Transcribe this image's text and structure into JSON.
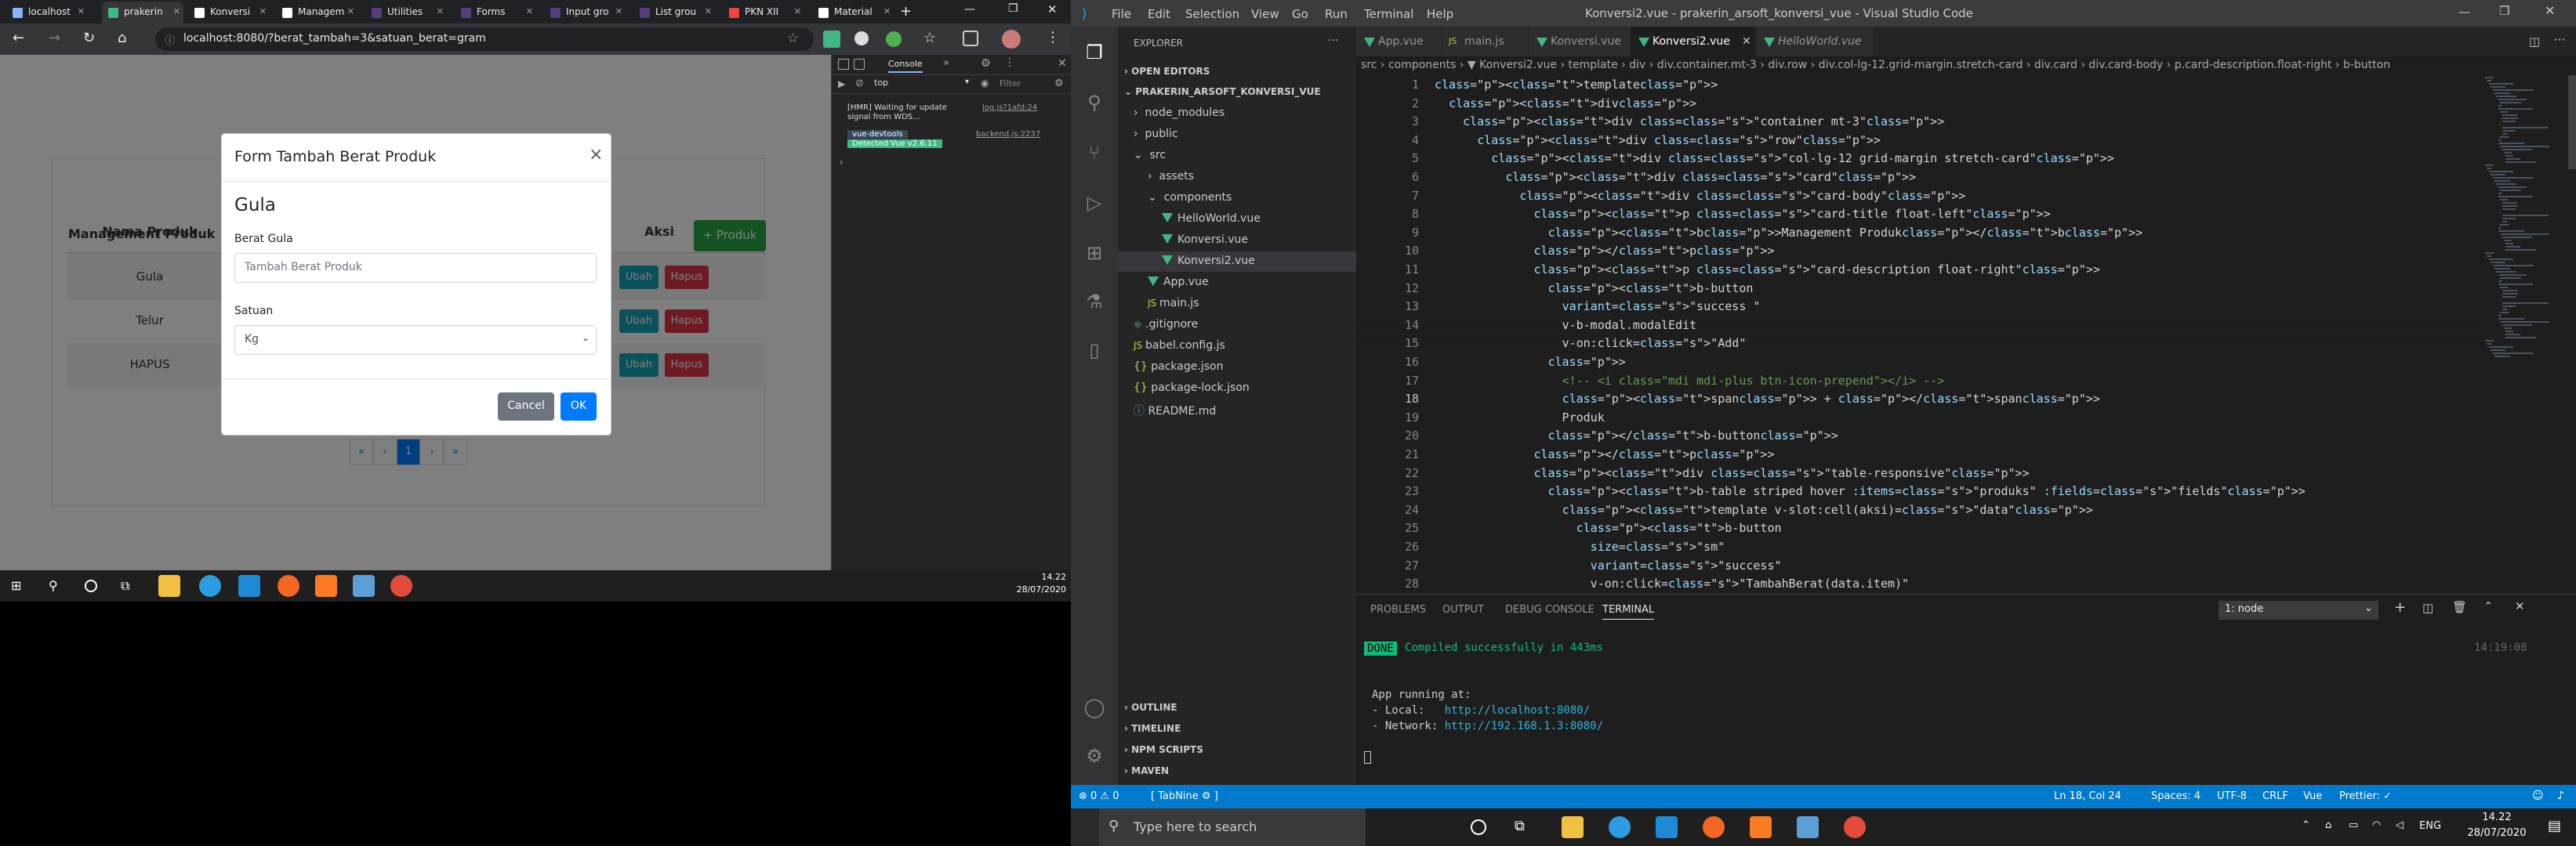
{
  "chrome": {
    "tabs": [
      "localhost",
      "prakerin",
      "Konversi",
      "Managem",
      "Utilities",
      "Forms",
      "Input gro",
      "List grou",
      "PKN XII",
      "Material"
    ],
    "url": "localhost:8080/?berat_tambah=3&satuan_berat=gram"
  },
  "page": {
    "card_title": "Management Produk",
    "add_button": "+ Produk",
    "columns": [
      "Nama Produk",
      "Aksi"
    ],
    "rows": [
      {
        "name": "Gula",
        "edit": "Ubah",
        "delete": "Hapus"
      },
      {
        "name": "Telur",
        "edit": "Ubah",
        "delete": "Hapus"
      },
      {
        "name": "HAPUS",
        "edit": "Ubah",
        "delete": "Hapus"
      }
    ],
    "pagination": [
      "«",
      "‹",
      "1",
      "›",
      "»"
    ]
  },
  "modal": {
    "title": "Form Tambah Berat Produk",
    "close": "×",
    "product": "Gula",
    "weight_label": "Berat Gula",
    "weight_placeholder": "Tambah Berat Produk",
    "unit_label": "Satuan",
    "unit_value": "Kg",
    "cancel": "Cancel",
    "ok": "OK"
  },
  "devtools": {
    "tab": "Console",
    "context": "top",
    "filter": "Filter",
    "log1": "[HMR] Waiting for update signal from WDS...",
    "log1_src": "log.js?1afd:24",
    "log2a": "vue-devtools",
    "log2b": "Detected Vue v2.6.11",
    "log2_src": "backend.js:2237",
    "prompt": "›"
  },
  "left_taskbar": {
    "time": "14.22",
    "date": "28/07/2020"
  },
  "vscode": {
    "title": "Konversi2.vue - prakerin_arsoft_konversi_vue - Visual Studio Code",
    "menu": [
      "File",
      "Edit",
      "Selection",
      "View",
      "Go",
      "Run",
      "Terminal",
      "Help"
    ],
    "explorer": {
      "header": "EXPLORER",
      "open_editors": "OPEN EDITORS",
      "project": "PRAKERIN_ARSOFT_KONVERSI_VUE",
      "items": [
        {
          "label": "node_modules",
          "type": "folder"
        },
        {
          "label": "public",
          "type": "folder"
        },
        {
          "label": "src",
          "type": "folder-open"
        },
        {
          "label": "assets",
          "type": "folder"
        },
        {
          "label": "components",
          "type": "folder-open"
        },
        {
          "label": "HelloWorld.vue",
          "type": "vue"
        },
        {
          "label": "Konversi.vue",
          "type": "vue"
        },
        {
          "label": "Konversi2.vue",
          "type": "vue"
        },
        {
          "label": "App.vue",
          "type": "vue"
        },
        {
          "label": "main.js",
          "type": "js"
        },
        {
          "label": ".gitignore",
          "type": "git"
        },
        {
          "label": "babel.config.js",
          "type": "js"
        },
        {
          "label": "package.json",
          "type": "json"
        },
        {
          "label": "package-lock.json",
          "type": "json"
        },
        {
          "label": "README.md",
          "type": "info"
        }
      ],
      "bottom": [
        "OUTLINE",
        "TIMELINE",
        "NPM SCRIPTS",
        "MAVEN"
      ]
    },
    "tabs": [
      "App.vue",
      "main.js",
      "Konversi.vue",
      "Konversi2.vue",
      "HelloWorld.vue"
    ],
    "breadcrumb": "src › components › ▼ Konversi2.vue › template › div › div.container.mt-3 › div.row › div.col-lg-12.grid-margin.stretch-card › div.card › div.card-body › p.card-description.float-right › b-button",
    "code_lines": [
      "<template>",
      "  <div>",
      "    <div class=\"container mt-3\">",
      "      <div class=\"row\">",
      "        <div class=\"col-lg-12 grid-margin stretch-card\">",
      "          <div class=\"card\">",
      "            <div class=\"card-body\">",
      "              <p class=\"card-title float-left\">",
      "                <b>Management Produk</b>",
      "              </p>",
      "              <p class=\"card-description float-right\">",
      "                <b-button",
      "                  variant=\"success \"",
      "                  v-b-modal.modalEdit",
      "                  v-on:click=\"Add\"",
      "                >",
      "                  <!-- <i class=\"mdi mdi-plus btn-icon-prepend\"></i> -->",
      "                  <span> + </span>",
      "                  Produk",
      "                </b-button>",
      "              </p>",
      "              <div class=\"table-responsive\">",
      "                <b-table striped hover :items=\"produks\" :fields=\"fields\">",
      "                  <template v-slot:cell(aksi)=\"data\">",
      "                    <b-button",
      "                      size=\"sm\"",
      "                      variant=\"success\"",
      "                      v-on:click=\"TambahBerat(data.item)\""
    ],
    "panel": {
      "tabs": [
        "PROBLEMS",
        "OUTPUT",
        "DEBUG CONSOLE",
        "TERMINAL"
      ],
      "terminal_select": "1: node",
      "done": "DONE",
      "compiled": "Compiled successfully in 443ms",
      "timestamp": "14:19:08",
      "running": "App running at:",
      "local_label": "- Local:   ",
      "local_url": "http://localhost:8080/",
      "network_label": "- Network: ",
      "network_url": "http://192.168.1.3:8080/"
    },
    "status": {
      "errors": "⊗ 0 ⚠ 0",
      "tabnine": "[ TabNine ⚙ ]",
      "position": "Ln 18, Col 24",
      "spaces": "Spaces: 4",
      "encoding": "UTF-8",
      "eol": "CRLF",
      "language": "Vue",
      "prettier": "Prettier: ✓"
    }
  },
  "right_taskbar": {
    "search": "Type here to search",
    "lang": "ENG",
    "time": "14.22",
    "date": "28/07/2020"
  }
}
